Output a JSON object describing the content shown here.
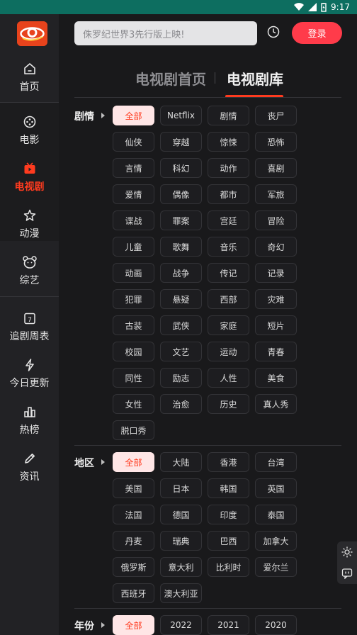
{
  "status_bar": {
    "time": "9:17",
    "icons": [
      "wifi-icon",
      "signal-icon",
      "battery-icon"
    ]
  },
  "sidebar": {
    "items": [
      {
        "label": "首页",
        "icon": "home-icon"
      },
      {
        "label": "电影",
        "icon": "film-reel-icon"
      },
      {
        "label": "电视剧",
        "icon": "tv-icon",
        "active": true
      },
      {
        "label": "动漫",
        "icon": "anime-star-icon"
      },
      {
        "label": "综艺",
        "icon": "bear-icon"
      },
      {
        "label": "追剧周表",
        "icon": "calendar-icon"
      },
      {
        "label": "今日更新",
        "icon": "lightning-icon"
      },
      {
        "label": "热榜",
        "icon": "bar-chart-icon"
      },
      {
        "label": "资讯",
        "icon": "pencil-icon"
      }
    ]
  },
  "search": {
    "placeholder": "侏罗纪世界3先行版上映!"
  },
  "login": {
    "label": "登录"
  },
  "tabs": {
    "home": "电视剧首页",
    "library": "电视剧库"
  },
  "filters": {
    "genre": {
      "label": "剧情",
      "options": [
        "全部",
        "Netflix",
        "剧情",
        "丧尸",
        "仙侠",
        "穿越",
        "惊悚",
        "恐怖",
        "言情",
        "科幻",
        "动作",
        "喜剧",
        "爱情",
        "偶像",
        "都市",
        "军旅",
        "谍战",
        "罪案",
        "宫廷",
        "冒险",
        "儿童",
        "歌舞",
        "音乐",
        "奇幻",
        "动画",
        "战争",
        "传记",
        "记录",
        "犯罪",
        "悬疑",
        "西部",
        "灾难",
        "古装",
        "武侠",
        "家庭",
        "短片",
        "校园",
        "文艺",
        "运动",
        "青春",
        "同性",
        "励志",
        "人性",
        "美食",
        "女性",
        "治愈",
        "历史",
        "真人秀",
        "脱口秀"
      ],
      "selected": "全部"
    },
    "region": {
      "label": "地区",
      "options": [
        "全部",
        "大陆",
        "香港",
        "台湾",
        "美国",
        "日本",
        "韩国",
        "英国",
        "法国",
        "德国",
        "印度",
        "泰国",
        "丹麦",
        "瑞典",
        "巴西",
        "加拿大",
        "俄罗斯",
        "意大利",
        "比利时",
        "爱尔兰",
        "西班牙",
        "澳大利亚"
      ],
      "selected": "全部"
    },
    "year": {
      "label": "年份",
      "options": [
        "全部",
        "2022",
        "2021",
        "2020"
      ],
      "selected": "全部"
    }
  },
  "colors": {
    "accent": "#ff3b1f",
    "login": "#ff3b4a",
    "status_bar": "#0d6e60",
    "background": "#19191b"
  }
}
